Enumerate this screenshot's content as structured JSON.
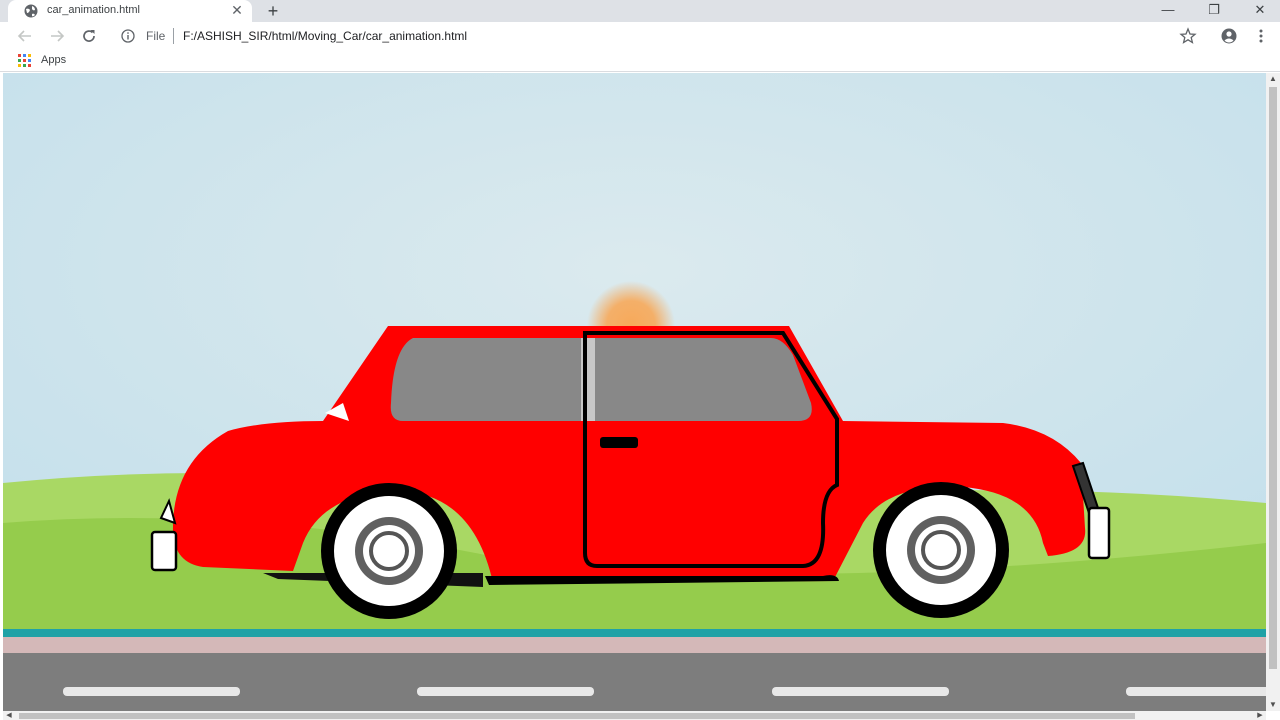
{
  "browser": {
    "tab": {
      "title": "car_animation.html",
      "close_glyph": "✕",
      "icon": "globe-icon"
    },
    "new_tab_glyph": "+",
    "window_controls": {
      "minimize": "—",
      "restore": "❐",
      "close": "✕"
    },
    "address_bar": {
      "scheme_label": "File",
      "url": "F:/ASHISH_SIR/html/Moving_Car/car_animation.html"
    },
    "bookmarks": {
      "apps_label": "Apps"
    }
  },
  "scene": {
    "sky_color": "#c6e0ec",
    "sun_color": "#f7a95a",
    "hill_color": "#9dd158",
    "road_color": "#7d7d7d",
    "road_stripe_color": "#e8e8e8",
    "curb_teal_color": "#1fa2a6",
    "curb_pink_color": "#d4b8b8",
    "car": {
      "body_color": "#ff0000",
      "window_color": "#888888",
      "outline_color": "#000000",
      "rim_color": "#ffffff"
    }
  }
}
